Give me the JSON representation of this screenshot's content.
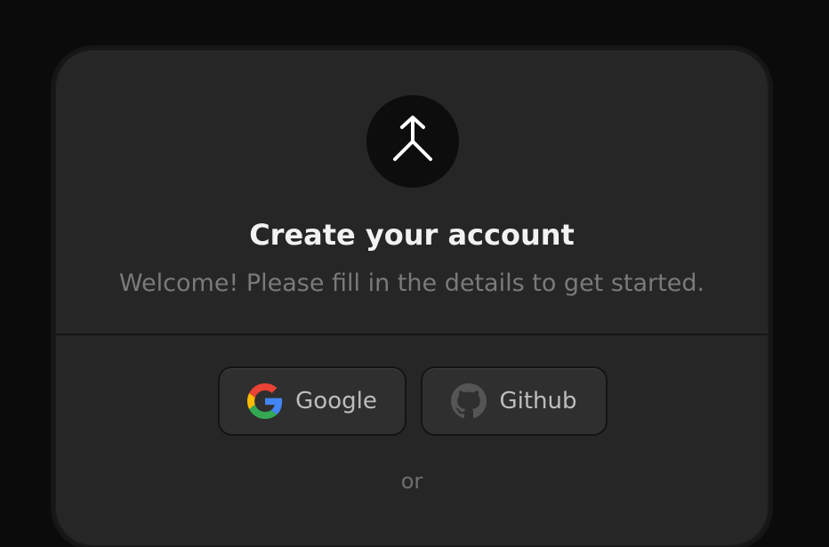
{
  "auth": {
    "title": "Create your account",
    "subtitle": "Welcome! Please fill in the details to get started.",
    "logo_icon": "merge-arrow-icon",
    "providers": [
      {
        "label": "Google",
        "icon": "google-icon"
      },
      {
        "label": "Github",
        "icon": "github-icon"
      }
    ],
    "separator": "or"
  },
  "colors": {
    "background": "#0b0b0b",
    "card": "#262626",
    "title_text": "#f2f2f2",
    "muted_text": "#7a7a7a",
    "button": "#2f2f2f"
  }
}
